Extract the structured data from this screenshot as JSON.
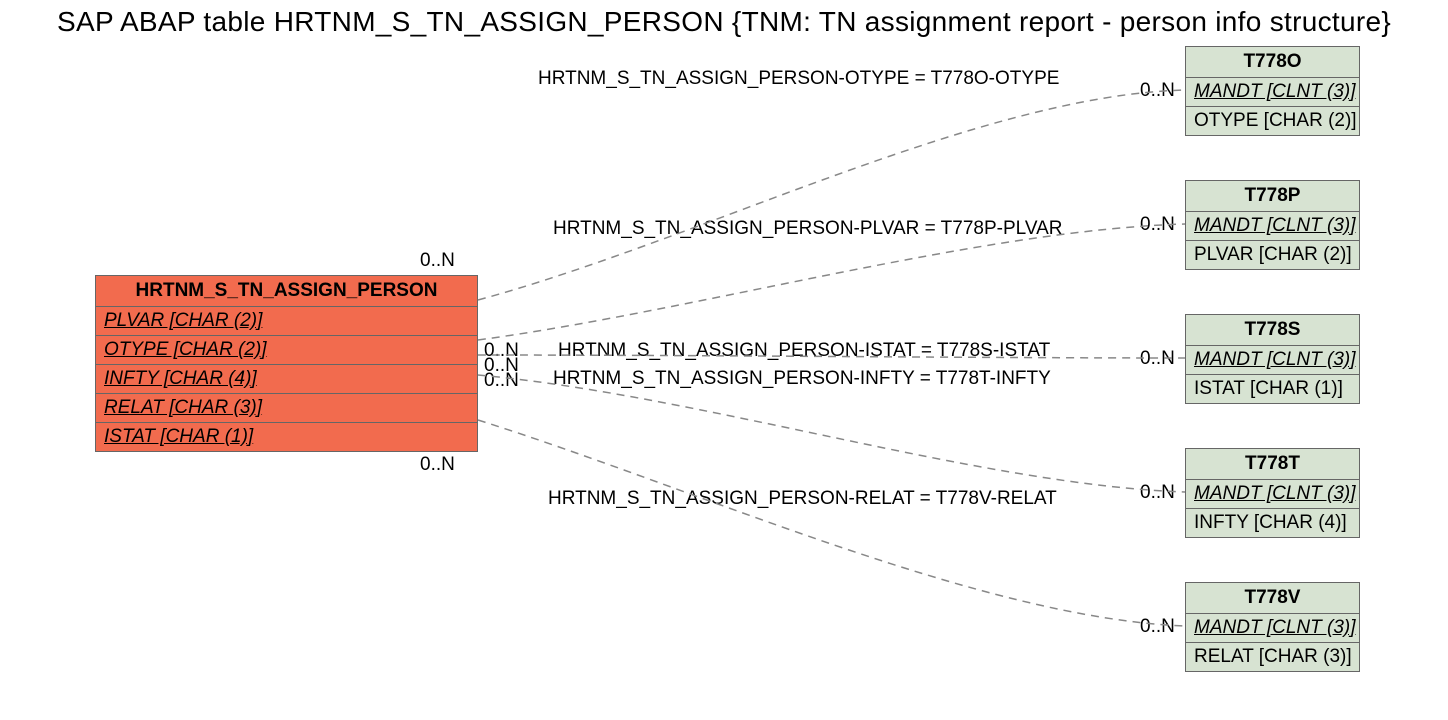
{
  "title": "SAP ABAP table HRTNM_S_TN_ASSIGN_PERSON {TNM: TN assignment report - person info structure}",
  "mainEntity": {
    "name": "HRTNM_S_TN_ASSIGN_PERSON",
    "fields": [
      "PLVAR [CHAR (2)]",
      "OTYPE [CHAR (2)]",
      "INFTY [CHAR (4)]",
      "RELAT [CHAR (3)]",
      "ISTAT [CHAR (1)]"
    ]
  },
  "refEntities": [
    {
      "name": "T778O",
      "f1": "MANDT [CLNT (3)]",
      "f2": "OTYPE [CHAR (2)]"
    },
    {
      "name": "T778P",
      "f1": "MANDT [CLNT (3)]",
      "f2": "PLVAR [CHAR (2)]"
    },
    {
      "name": "T778S",
      "f1": "MANDT [CLNT (3)]",
      "f2": "ISTAT [CHAR (1)]"
    },
    {
      "name": "T778T",
      "f1": "MANDT [CLNT (3)]",
      "f2": "INFTY [CHAR (4)]"
    },
    {
      "name": "T778V",
      "f1": "MANDT [CLNT (3)]",
      "f2": "RELAT [CHAR (3)]"
    }
  ],
  "relLabels": {
    "r1": "HRTNM_S_TN_ASSIGN_PERSON-OTYPE = T778O-OTYPE",
    "r2": "HRTNM_S_TN_ASSIGN_PERSON-PLVAR = T778P-PLVAR",
    "r3": "HRTNM_S_TN_ASSIGN_PERSON-ISTAT = T778S-ISTAT",
    "r4": "HRTNM_S_TN_ASSIGN_PERSON-INFTY = T778T-INFTY",
    "r5": "HRTNM_S_TN_ASSIGN_PERSON-RELAT = T778V-RELAT"
  },
  "card": {
    "leftTop": "0..N",
    "leftMid1": "0..N",
    "leftMid2": "0..N",
    "leftMid3": "0..N",
    "leftBot": "0..N",
    "right1": "0..N",
    "right2": "0..N",
    "right3": "0..N",
    "right4": "0..N",
    "right5": "0..N"
  }
}
